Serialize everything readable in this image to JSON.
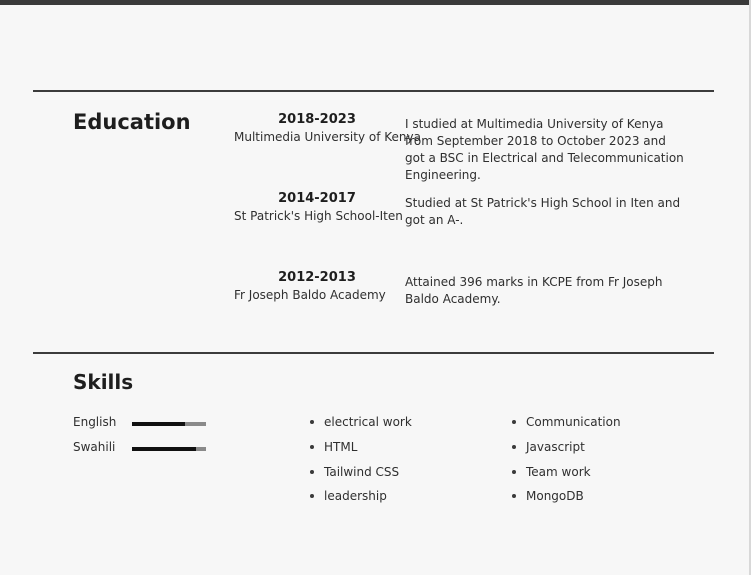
{
  "education": {
    "heading": "Education",
    "entries": [
      {
        "years": "2018-2023",
        "school": "Multimedia University of Kenya",
        "description": "I studied at Multimedia University of Kenya from September 2018 to October 2023 and got a BSC in Electrical and Telecommunication Engineering."
      },
      {
        "years": "2014-2017",
        "school": "St Patrick's High School-Iten",
        "description": "Studied at St Patrick's High School in Iten and got an A-."
      },
      {
        "years": "2012-2013",
        "school": "Fr Joseph Baldo Academy",
        "description": "Attained 396 marks in KCPE from Fr Joseph Baldo Academy."
      }
    ]
  },
  "skills": {
    "heading": "Skills",
    "languages": [
      {
        "name": "English",
        "level": 0.71
      },
      {
        "name": "Swahili",
        "level": 0.86
      }
    ],
    "column1": [
      "electrical work",
      "HTML",
      "Tailwind CSS",
      "leadership"
    ],
    "column2": [
      "Communication",
      "Javascript",
      "Team work",
      "MongoDB"
    ]
  }
}
